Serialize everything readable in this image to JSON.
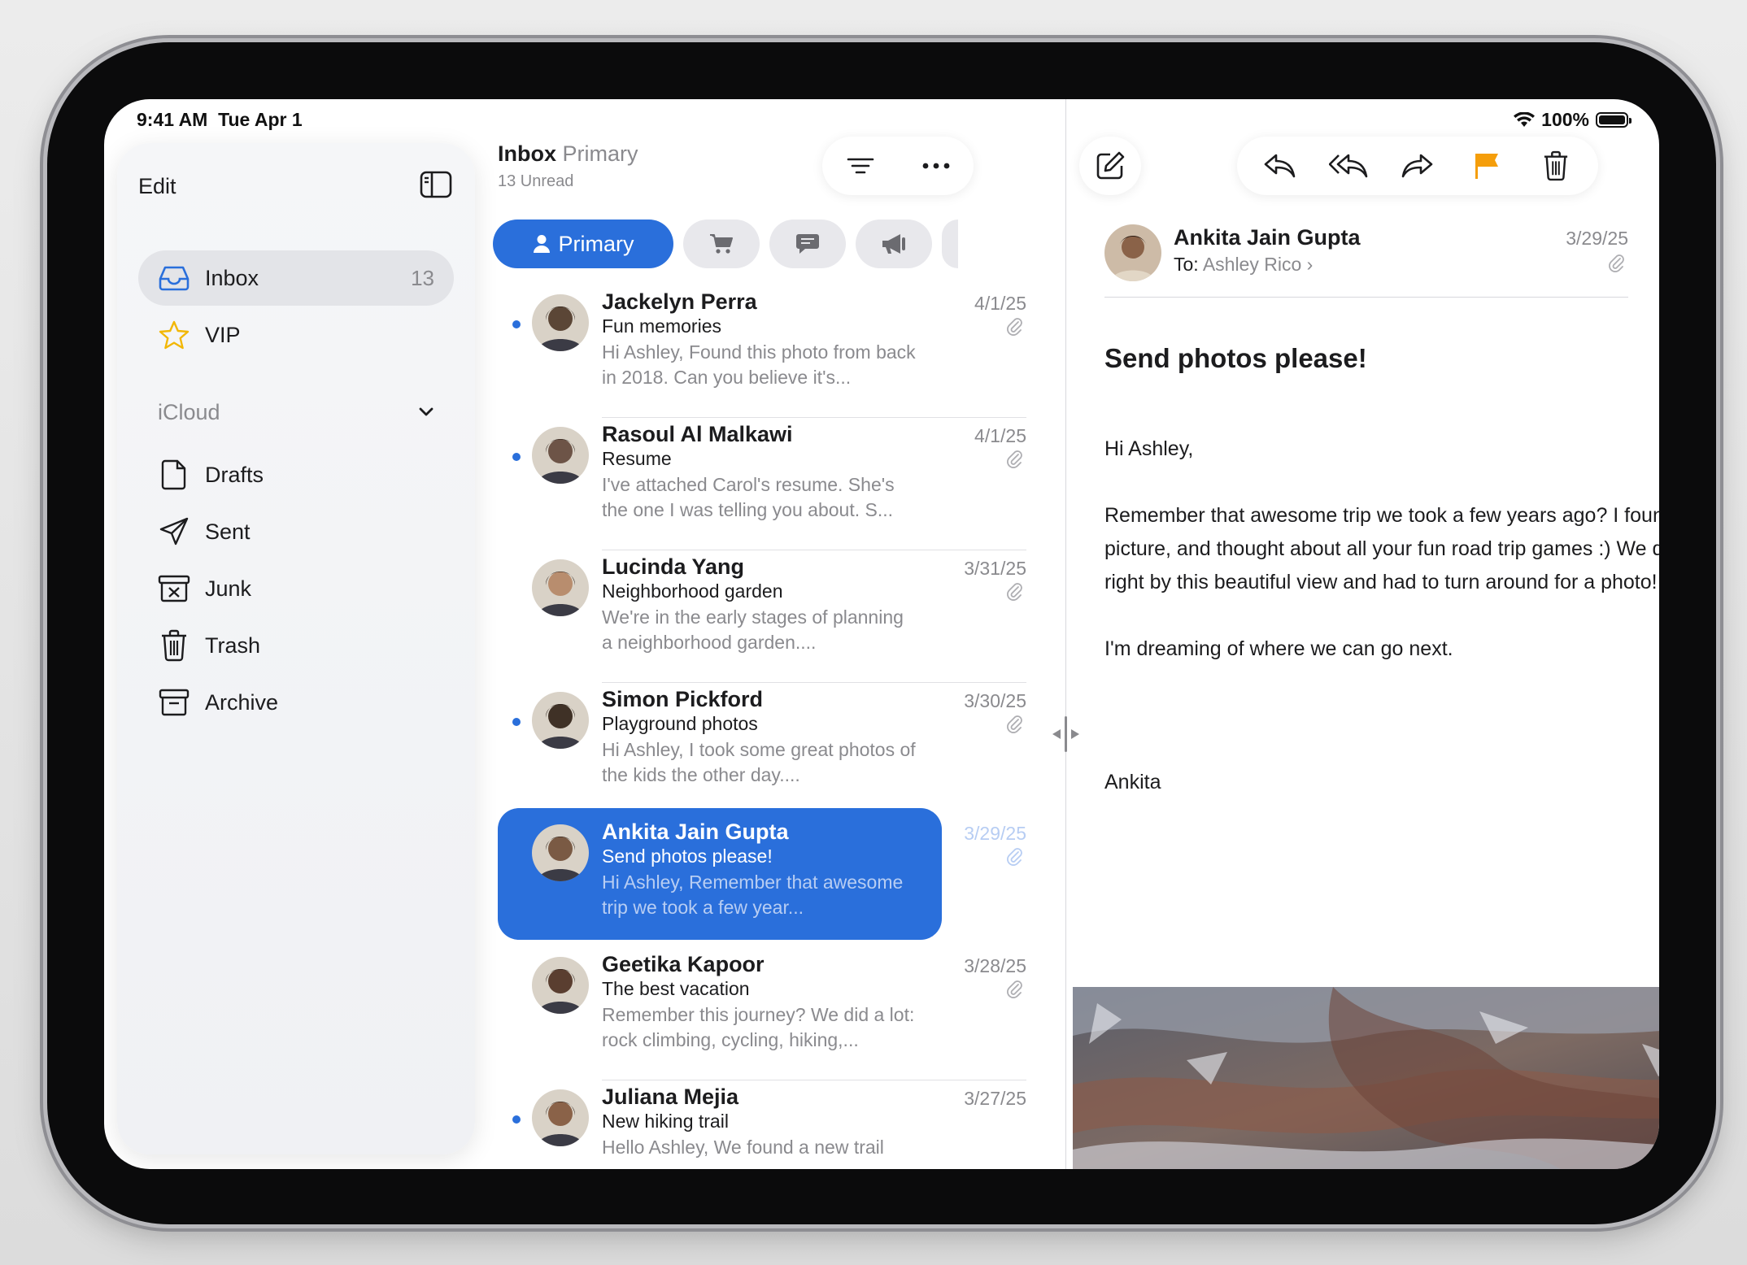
{
  "status": {
    "time": "9:41 AM  Tue Apr 1",
    "battery": "100%"
  },
  "sidebar": {
    "edit_label": "Edit",
    "inbox": {
      "label": "Inbox",
      "count": "13"
    },
    "vip": {
      "label": "VIP"
    },
    "section": "iCloud",
    "folders": [
      {
        "label": "Drafts",
        "icon": "drafts-icon"
      },
      {
        "label": "Sent",
        "icon": "sent-icon"
      },
      {
        "label": "Junk",
        "icon": "junk-icon"
      },
      {
        "label": "Trash",
        "icon": "trash-icon"
      },
      {
        "label": "Archive",
        "icon": "archive-icon"
      }
    ]
  },
  "list": {
    "title": "Inbox",
    "title_sub": "Primary",
    "unread": "13 Unread",
    "primary_tab": "Primary",
    "messages": [
      {
        "from": "Jackelyn Perra",
        "date": "4/1/25",
        "subject": "Fun memories",
        "preview": "Hi Ashley, Found this photo from back in 2018. Can you believe it's...",
        "unread": true,
        "avatar_color": "#5b4636"
      },
      {
        "from": "Rasoul Al Malkawi",
        "date": "4/1/25",
        "subject": "Resume",
        "preview": "I've attached Carol's resume. She's the one I was telling you about. S...",
        "unread": true,
        "avatar_color": "#6d5447"
      },
      {
        "from": "Lucinda Yang",
        "date": "3/31/25",
        "subject": "Neighborhood garden",
        "preview": "We're in the early stages of planning a neighborhood garden....",
        "unread": false,
        "avatar_color": "#b88d6e"
      },
      {
        "from": "Simon Pickford",
        "date": "3/30/25",
        "subject": "Playground photos",
        "preview": "Hi Ashley, I took some great photos of the kids the other day....",
        "unread": true,
        "avatar_color": "#3f3126"
      },
      {
        "from": "Ankita Jain Gupta",
        "date": "3/29/25",
        "subject": "Send photos please!",
        "preview": "Hi Ashley, Remember that awesome trip we took a few year...",
        "unread": false,
        "avatar_color": "#7a5a44"
      },
      {
        "from": "Geetika Kapoor",
        "date": "3/28/25",
        "subject": "The best vacation",
        "preview": "Remember this journey? We did a lot: rock climbing, cycling, hiking,...",
        "unread": false,
        "avatar_color": "#5a3e30"
      },
      {
        "from": "Juliana Mejia",
        "date": "3/27/25",
        "subject": "New hiking trail",
        "preview": "Hello Ashley, We found a new trail",
        "unread": true,
        "avatar_color": "#8a6248"
      }
    ]
  },
  "detail": {
    "from": "Ankita Jain Gupta",
    "to_label": "To:",
    "to": "Ashley Rico",
    "date": "3/29/25",
    "subject": "Send photos please!",
    "body": [
      "Hi Ashley,",
      "Remember that awesome trip we took a few years ago? I found this picture, and thought about all your fun road trip games :) We drove right by this beautiful view and had to turn around for a photo!",
      "I'm dreaming of where we can go next.",
      "",
      "Ankita"
    ]
  },
  "colors": {
    "accent": "#2a6fdb",
    "flag": "#f59e0b",
    "secondary_text": "#8a8a8e"
  }
}
